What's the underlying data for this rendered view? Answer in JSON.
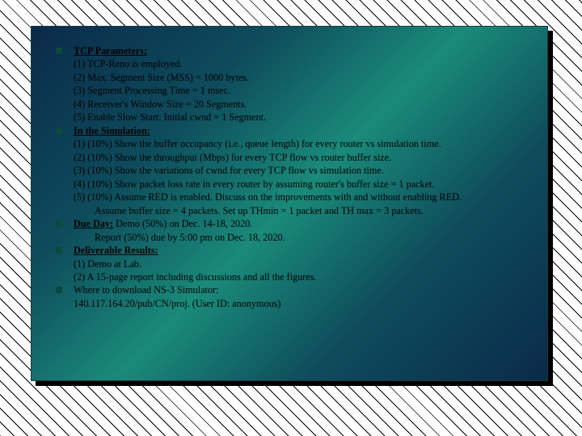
{
  "s0": {
    "h": "TCP Parameters:",
    "l": [
      "(1) TCP-Reno is employed.",
      "(2) Max. Segment Size (MSS) = 1000 bytes.",
      "(3) Segment Processing Time = 1 msec.",
      "(4) Receiver's Window  Size = 20 Segments.",
      "(5) Enable Slow Start: Initial cwnd  = 1 Segment."
    ]
  },
  "s1": {
    "h": "In the Simulation:",
    "l": [
      "(1) (10%) Show  the buffer occupancy (i.e., queue length) for every router vs simulation time.",
      "(2) (10%) Show the throughput (Mbps) for every TCP flow vs router buffer size.",
      "(3) (10%) Show the variations of cwnd for every TCP flow vs simulation time.",
      "(4) (10%) Show packet loss rate in every router by assuming router's buffer size = 1 packet.",
      "(5) (10%) Assume RED is enabled. Discuss on the improvements with and without enabling RED."
    ],
    "tail": "Assume buffer size = 4 packets. Set up THmin = 1  packet and TH max = 3 packets."
  },
  "s2": {
    "h": "Due Day:",
    "t": "  Demo (50%) on Dec. 14-18, 2020.",
    "tail": "Report (50%) due by 5:00 pm on Dec. 18, 2020."
  },
  "s3": {
    "h": "Deliverable Results:",
    "l": [
      "(1) Demo at Lab.",
      "(2) A 15-page report  including discussions and all the figures."
    ]
  },
  "s4": {
    "t": "Where to download NS-3 Simulator:",
    "l": [
      "140.117.164.20/pub/CN/proj.     (User ID: anonymous)"
    ]
  }
}
